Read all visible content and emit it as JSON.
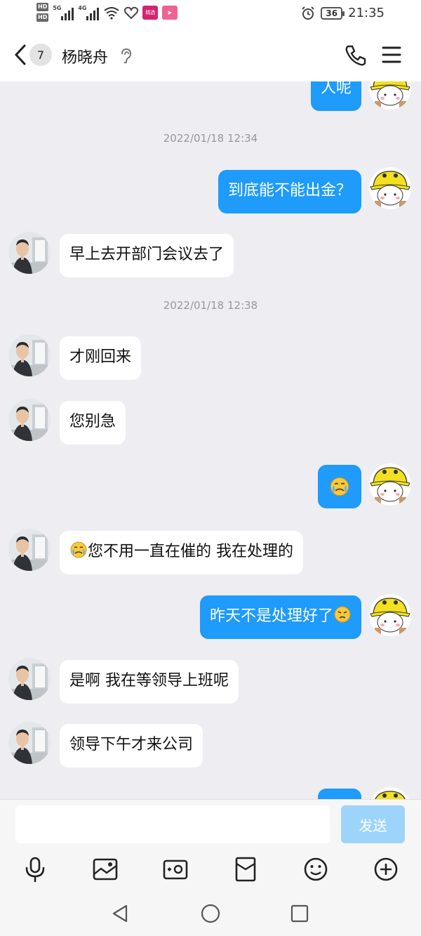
{
  "status_bar": {
    "signal_tags": [
      "HD",
      "HD",
      "5G",
      "4G"
    ],
    "app_badge_text": "精选",
    "battery": "36",
    "time": "21:35"
  },
  "header": {
    "unread_count": "7",
    "contact_name": "杨晓舟"
  },
  "messages": {
    "m0": "人呢",
    "ts1": "2022/01/18 12:34",
    "m1": "到底能不能出金？",
    "m2": "早上去开部门会议去了",
    "ts2": "2022/01/18 12:38",
    "m3": "才刚回来",
    "m4": "您别急",
    "m6": "您不用一直在催的  我在处理的",
    "m7": "昨天不是处理好了",
    "m8": "是啊 我在等领导上班呢",
    "m9": "领导下午才来公司"
  },
  "input": {
    "placeholder": "",
    "send_label": "发送"
  },
  "icons": {
    "back": "chevron-left-icon",
    "ear": "ear-icon",
    "phone": "phone-icon",
    "menu": "menu-icon",
    "toolbar": [
      "microphone-icon",
      "image-icon",
      "camera-icon",
      "red-packet-icon",
      "emoji-icon",
      "plus-icon"
    ],
    "nav": [
      "back-triangle-icon",
      "home-circle-icon",
      "recents-square-icon"
    ]
  },
  "colors": {
    "outgoing_bubble": "#1e9bfb",
    "incoming_bubble": "#ffffff",
    "chat_background": "#ededf2",
    "send_button": "#9dd4fb"
  }
}
